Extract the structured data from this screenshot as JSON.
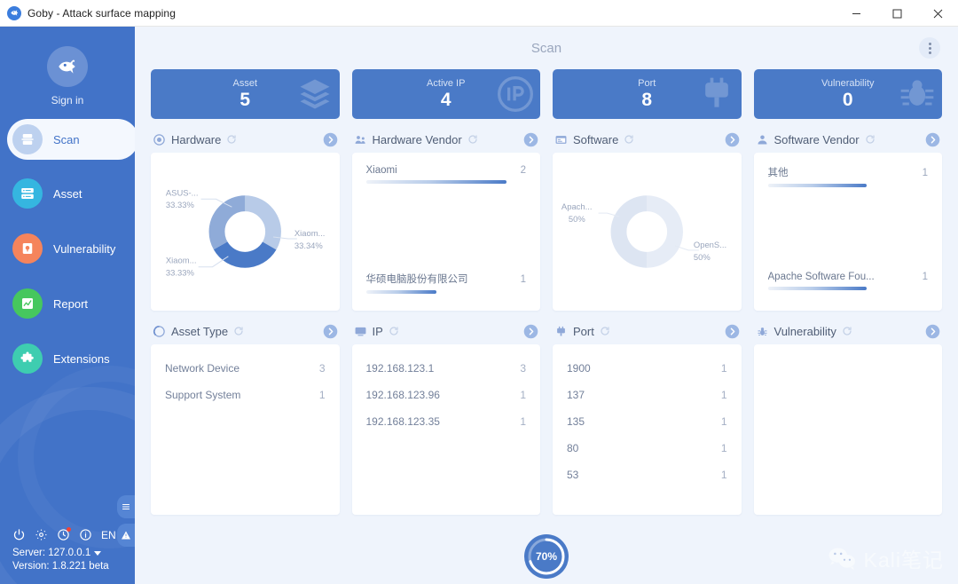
{
  "window": {
    "title": "Goby - Attack surface mapping",
    "logo_icon": "goby-fish-logo-icon",
    "controls": [
      {
        "name": "minimize",
        "icon": "minimize-icon"
      },
      {
        "name": "maximize",
        "icon": "maximize-icon"
      },
      {
        "name": "close",
        "icon": "close-icon"
      }
    ]
  },
  "sidebar": {
    "signin": {
      "label": "Sign in",
      "icon": "goby-fish-avatar-icon"
    },
    "items": [
      {
        "label": "Scan",
        "icon": "scan-icon",
        "active": true,
        "icon_bg": "#bdd1ef"
      },
      {
        "label": "Asset",
        "icon": "asset-icon",
        "active": false,
        "icon_bg": "#35b6e0"
      },
      {
        "label": "Vulnerability",
        "icon": "vulnerability-icon",
        "active": false,
        "icon_bg": "#f5845c"
      },
      {
        "label": "Report",
        "icon": "report-icon",
        "active": false,
        "icon_bg": "#46c75e"
      },
      {
        "label": "Extensions",
        "icon": "extensions-icon",
        "active": false,
        "icon_bg": "#3ecdb0"
      }
    ],
    "bottom_icons": [
      {
        "name": "power-icon",
        "badge": false
      },
      {
        "name": "gear-icon",
        "badge": false
      },
      {
        "name": "clock-icon",
        "badge": true
      },
      {
        "name": "info-icon",
        "badge": false
      }
    ],
    "language": "EN",
    "server_label": "Server: 127.0.0.1",
    "version_label": "Version: 1.8.221 beta",
    "tabs": [
      {
        "name": "menu-tab",
        "icon": "hamburger-icon"
      },
      {
        "name": "warning-tab",
        "icon": "warning-triangle-icon"
      }
    ]
  },
  "main": {
    "page_title": "Scan",
    "kebab_icon": "more-vertical-icon",
    "progress": {
      "value": "70%",
      "percent": 70
    },
    "watermark": {
      "text": "Kali笔记",
      "icon": "wechat-icon"
    }
  },
  "stats": [
    {
      "label": "Asset",
      "value": "5",
      "icon": "layers-icon"
    },
    {
      "label": "Active IP",
      "value": "4",
      "icon": "ip-icon"
    },
    {
      "label": "Port",
      "value": "8",
      "icon": "port-plug-icon"
    },
    {
      "label": "Vulnerability",
      "value": "0",
      "icon": "bug-icon"
    }
  ],
  "panels_top": [
    {
      "title": "Hardware",
      "icon": "target-circle-icon",
      "refresh_icon": "refresh-icon",
      "more_icon": "chevron-right-circle-icon",
      "kind": "donut"
    },
    {
      "title": "Hardware Vendor",
      "icon": "vendor-people-icon",
      "refresh_icon": "refresh-icon",
      "more_icon": "chevron-right-circle-icon",
      "kind": "bars"
    },
    {
      "title": "Software",
      "icon": "software-window-icon",
      "refresh_icon": "refresh-icon",
      "more_icon": "chevron-right-circle-icon",
      "kind": "donut"
    },
    {
      "title": "Software Vendor",
      "icon": "person-icon",
      "refresh_icon": "refresh-icon",
      "more_icon": "chevron-right-circle-icon",
      "kind": "bars"
    }
  ],
  "panels_bottom": [
    {
      "title": "Asset Type",
      "icon": "asset-type-icon",
      "refresh_icon": "refresh-icon",
      "more_icon": "chevron-right-circle-icon"
    },
    {
      "title": "IP",
      "icon": "monitor-icon",
      "refresh_icon": "refresh-icon",
      "more_icon": "chevron-right-circle-icon"
    },
    {
      "title": "Port",
      "icon": "port-plug-icon",
      "refresh_icon": "refresh-icon",
      "more_icon": "chevron-right-circle-icon"
    },
    {
      "title": "Vulnerability",
      "icon": "bug-icon",
      "refresh_icon": "refresh-icon",
      "more_icon": "chevron-right-circle-icon"
    }
  ],
  "chart_data": [
    {
      "type": "pie",
      "title": "Hardware",
      "labels": [
        "ASUS-...",
        "Xiaom...",
        "Xiaom..."
      ],
      "values": [
        33.33,
        33.34,
        33.33
      ],
      "value_labels": [
        "33.33%",
        "33.34%",
        "33.33%"
      ],
      "colors": [
        "#b8cbe8",
        "#4a7ac7",
        "#8fabd8"
      ],
      "donut": true,
      "legend": "callout-labels"
    },
    {
      "type": "bar",
      "title": "Hardware Vendor",
      "orientation": "horizontal",
      "categories": [
        "Xiaomi",
        "华硕电脑股份有限公司"
      ],
      "values": [
        2,
        1
      ],
      "max": 2
    },
    {
      "type": "pie",
      "title": "Software",
      "labels": [
        "Apach...",
        "OpenS..."
      ],
      "values": [
        50,
        50
      ],
      "value_labels": [
        "50%",
        "50%"
      ],
      "colors": [
        "#dfe7f3",
        "#e8eef7"
      ],
      "donut": true,
      "legend": "callout-labels"
    },
    {
      "type": "bar",
      "title": "Software Vendor",
      "orientation": "horizontal",
      "categories": [
        "其他",
        "Apache Software Fou..."
      ],
      "values": [
        1,
        1
      ],
      "max": 1
    },
    {
      "type": "table",
      "title": "Asset Type",
      "columns": [
        "name",
        "count"
      ],
      "rows": [
        [
          "Network Device",
          "3"
        ],
        [
          "Support System",
          "1"
        ]
      ]
    },
    {
      "type": "table",
      "title": "IP",
      "columns": [
        "name",
        "count"
      ],
      "rows": [
        [
          "192.168.123.1",
          "3"
        ],
        [
          "192.168.123.96",
          "1"
        ],
        [
          "192.168.123.35",
          "1"
        ]
      ]
    },
    {
      "type": "table",
      "title": "Port",
      "columns": [
        "name",
        "count"
      ],
      "rows": [
        [
          "1900",
          "1"
        ],
        [
          "137",
          "1"
        ],
        [
          "135",
          "1"
        ],
        [
          "80",
          "1"
        ],
        [
          "53",
          "1"
        ]
      ]
    },
    {
      "type": "table",
      "title": "Vulnerability",
      "columns": [
        "name",
        "count"
      ],
      "rows": []
    }
  ],
  "colors": {
    "brand_blue": "#4273c8",
    "card_blue": "#4a7ac7",
    "bg": "#eff4fc",
    "panel_bg": "#ffffff",
    "muted_text": "#9aa6bd"
  }
}
